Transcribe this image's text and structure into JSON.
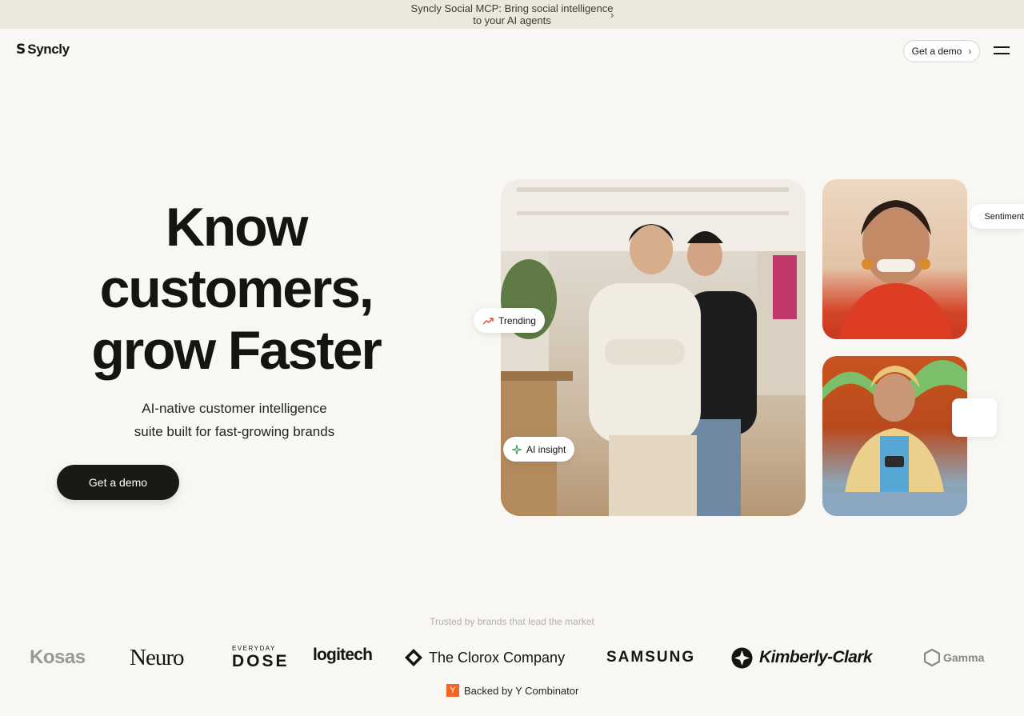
{
  "announcement": {
    "text": "Syncly Social MCP: Bring social intelligence to your AI agents",
    "chevron": "›"
  },
  "header": {
    "logo_mark": "S",
    "logo_text": "Syncly",
    "demo_button": "Get a demo",
    "demo_chevron": "›"
  },
  "hero": {
    "title_line1": "Know",
    "title_line2": "customers,",
    "title_line3": "grow Faster",
    "subtitle_line1": "AI-native customer intelligence",
    "subtitle_line2": "suite built for fast-growing brands",
    "cta": "Get a demo"
  },
  "chips": {
    "trending": "Trending",
    "ai_insight": "AI insight",
    "sentiment": "Sentiment"
  },
  "trusted": {
    "caption": "Trusted by brands that lead the market",
    "brands": {
      "kosas": "Kosas",
      "neuro": "Neuro",
      "dose_small": "EVERYDAY",
      "dose_big": "DOSE",
      "logitech": "logitech",
      "clorox": "The Clorox Company",
      "samsung": "SAMSUNG",
      "kimberly": "Kimberly-Clark",
      "gamma": "Gamma"
    }
  },
  "backed": {
    "badge": "Y",
    "text": "Backed by Y Combinator"
  },
  "colors": {
    "accent_dark": "#1a1916",
    "banner_bg": "#ebe7dc",
    "page_bg": "#f8f7f4",
    "yc_orange": "#f26522"
  }
}
